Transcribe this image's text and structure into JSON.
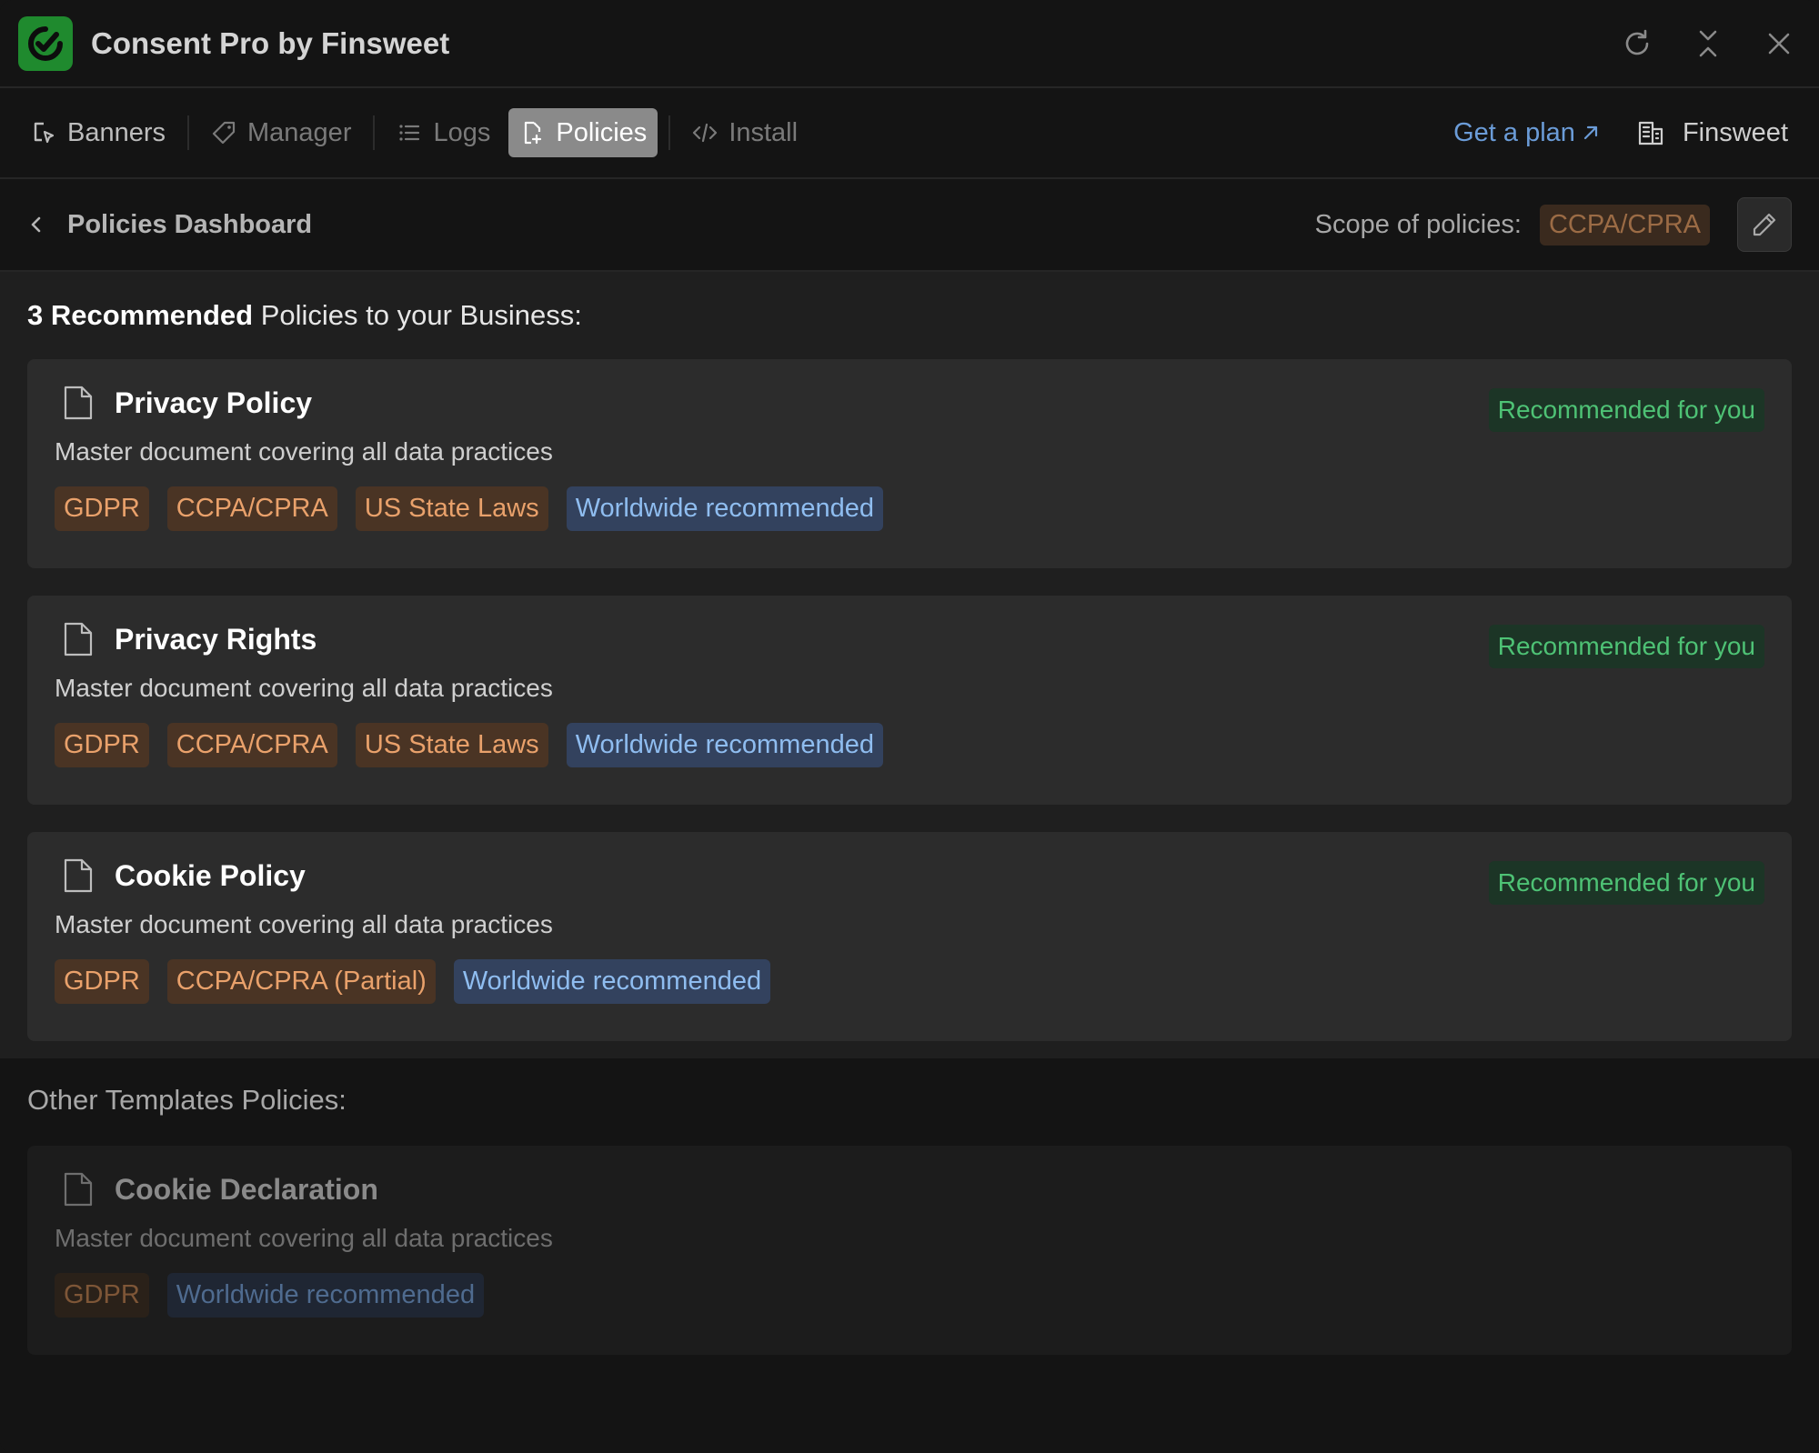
{
  "app": {
    "title": "Consent Pro by Finsweet"
  },
  "nav": {
    "items": [
      {
        "label": "Banners",
        "icon": "banner-cursor-icon"
      },
      {
        "label": "Manager",
        "icon": "tag-icon"
      },
      {
        "label": "Logs",
        "icon": "list-icon"
      },
      {
        "label": "Policies",
        "icon": "document-icon"
      },
      {
        "label": "Install",
        "icon": "code-icon"
      }
    ],
    "active": "Policies",
    "get_plan": "Get a plan",
    "workspace": "Finsweet"
  },
  "subheader": {
    "title": "Policies Dashboard",
    "scope_label": "Scope of policies:",
    "scope_value": "CCPA/CPRA"
  },
  "recommended": {
    "count": "3 Recommended",
    "heading_rest": " Policies to your Business:",
    "badge": "Recommended for you",
    "cards": [
      {
        "title": "Privacy Policy",
        "description": "Master document covering all data practices",
        "tags": [
          "GDPR",
          "CCPA/CPRA",
          "US State Laws",
          "Worldwide recommended"
        ]
      },
      {
        "title": "Privacy Rights",
        "description": "Master document covering all data practices",
        "tags": [
          "GDPR",
          "CCPA/CPRA",
          "US State Laws",
          "Worldwide recommended"
        ]
      },
      {
        "title": "Cookie Policy",
        "description": "Master document covering all data practices",
        "tags": [
          "GDPR",
          "CCPA/CPRA (Partial)",
          "Worldwide recommended"
        ]
      }
    ]
  },
  "other": {
    "heading": "Other Templates Policies:",
    "cards": [
      {
        "title": "Cookie Declaration",
        "description": "Master document covering all data practices",
        "tags": [
          "GDPR",
          "Worldwide recommended"
        ]
      }
    ]
  },
  "colors": {
    "brand": "#1f8a2e",
    "recommended_green": "#4ec275",
    "tag_orange": "#e9a16b",
    "tag_blue": "#8fbdf0",
    "link_blue": "#6b9cd8"
  }
}
